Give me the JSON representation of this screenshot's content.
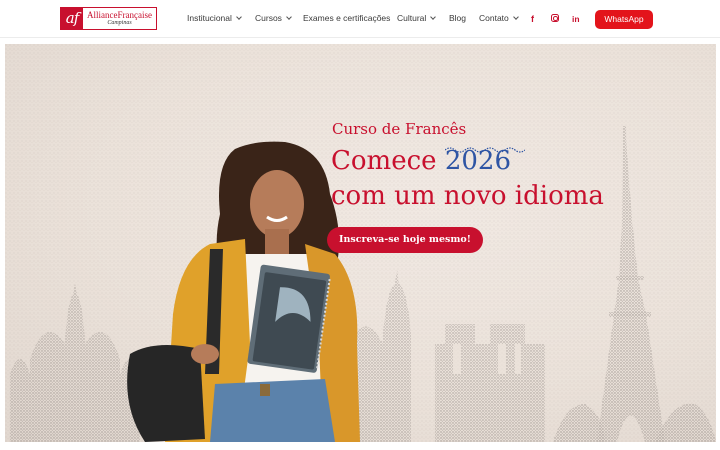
{
  "brand": {
    "mark": "af",
    "name": "AllianceFrançaise",
    "sub": "Campinas",
    "accent": "#c8102e"
  },
  "nav": {
    "items": [
      {
        "label": "Institucional",
        "has_dropdown": true
      },
      {
        "label": "Cursos",
        "has_dropdown": true
      },
      {
        "label": "Exames e certificações",
        "has_dropdown": false
      },
      {
        "label": "Cultural",
        "has_dropdown": true
      },
      {
        "label": "Blog",
        "has_dropdown": false
      },
      {
        "label": "Contato",
        "has_dropdown": true
      }
    ],
    "social": {
      "facebook": "f",
      "instagram": "instagram-icon",
      "linkedin": "in"
    },
    "whatsapp_label": "WhatsApp",
    "whatsapp_color": "#e3141b"
  },
  "hero": {
    "kicker": "Curso de Francês",
    "headline_start": "Comece",
    "headline_year": "2026",
    "headline_end": "com um novo idioma",
    "cta_label": "Inscreva-se hoje mesmo!",
    "year_color": "#2f55a4",
    "title_color": "#c8102e"
  }
}
